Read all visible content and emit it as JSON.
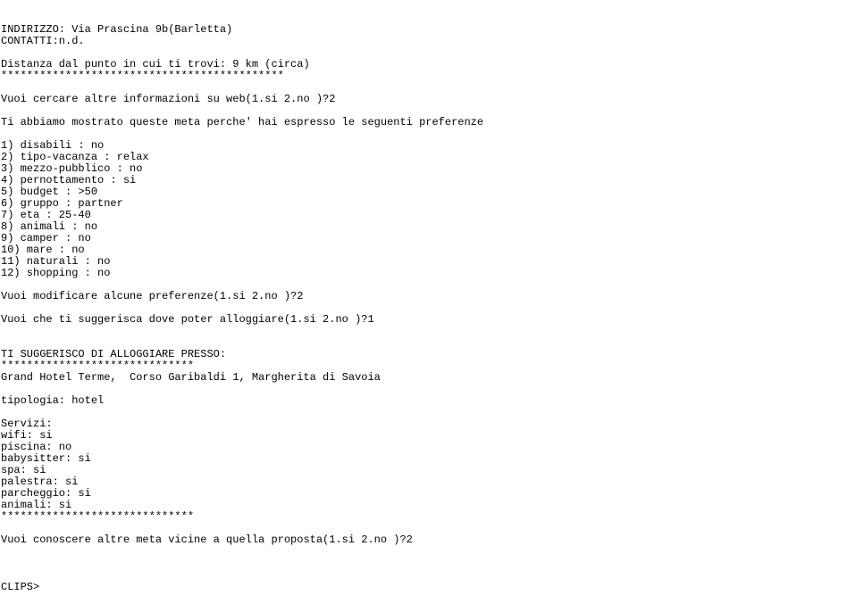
{
  "console": {
    "lines": [
      "INDIRIZZO: Via Prascina 9b(Barletta)",
      "CONTATTI:n.d.",
      "",
      "Distanza dal punto in cui ti trovi: 9 km (circa)",
      "********************************************",
      "",
      "Vuoi cercare altre informazioni su web(1.si 2.no )?2",
      "",
      "Ti abbiamo mostrato queste meta perche' hai espresso le seguenti preferenze",
      "",
      "1) disabili : no",
      "2) tipo-vacanza : relax",
      "3) mezzo-pubblico : no",
      "4) pernottamento : si",
      "5) budget : >50",
      "6) gruppo : partner",
      "7) eta : 25-40",
      "8) animali : no",
      "9) camper : no",
      "10) mare : no",
      "11) naturali : no",
      "12) shopping : no",
      "",
      "Vuoi modificare alcune preferenze(1.si 2.no )?2",
      "",
      "Vuoi che ti suggerisca dove poter alloggiare(1.si 2.no )?1",
      "",
      "",
      "TI SUGGERISCO DI ALLOGGIARE PRESSO:",
      "******************************",
      "Grand Hotel Terme,  Corso Garibaldi 1, Margherita di Savoia",
      "",
      "tipologia: hotel",
      "",
      "Servizi:",
      "wifi: si",
      "piscina: no",
      "babysitter: si",
      "spa: si",
      "palestra: si",
      "parcheggio: si",
      "animali: si",
      "******************************",
      "",
      "Vuoi conoscere altre meta vicine a quella proposta(1.si 2.no )?2",
      ""
    ],
    "prompt": "CLIPS>"
  }
}
